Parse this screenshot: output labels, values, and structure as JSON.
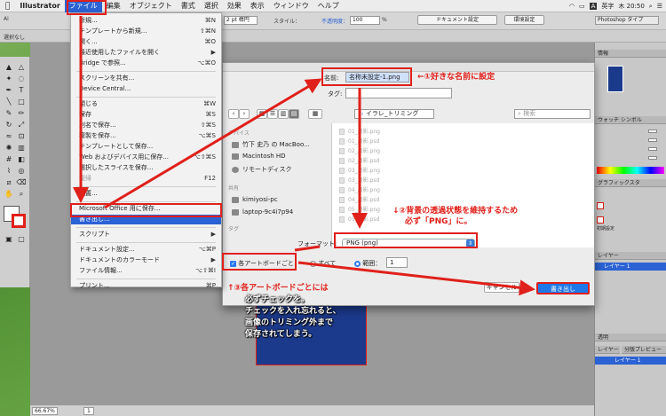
{
  "menubar": {
    "apple": "",
    "app": "Illustrator",
    "items": [
      "ファイル",
      "編集",
      "オブジェクト",
      "書式",
      "選択",
      "効果",
      "表示",
      "ウィンドウ",
      "ヘルプ"
    ],
    "status": [
      "A",
      "英字",
      "木 20:50"
    ]
  },
  "controlbar": {
    "select_label": "選択なし",
    "stroke_label": "2 pt 楕円",
    "style_label": "スタイル：",
    "opacity_label": "不透明度：",
    "opacity_value": "100",
    "opacity_unit": "%",
    "doc_settings": "ドキュメント設定",
    "env_settings": "環境設定",
    "workspace": "Photoshop タイプ"
  },
  "filemenu": {
    "items": [
      {
        "label": "新規...",
        "shortcut": "⌘N",
        "state": "normal"
      },
      {
        "label": "テンプレートから新規...",
        "shortcut": "⇧⌘N",
        "state": "normal"
      },
      {
        "label": "開く...",
        "shortcut": "⌘O",
        "state": "normal"
      },
      {
        "label": "最近使用したファイルを開く",
        "shortcut": "▶",
        "state": "normal"
      },
      {
        "label": "Bridge で参照...",
        "shortcut": "⌥⌘O",
        "state": "normal"
      },
      {
        "label": "スクリーンを共有...",
        "shortcut": "",
        "state": "normal"
      },
      {
        "label": "Device Central...",
        "shortcut": "",
        "state": "normal"
      },
      {
        "label": "閉じる",
        "shortcut": "⌘W",
        "state": "normal"
      },
      {
        "label": "保存",
        "shortcut": "⌘S",
        "state": "normal"
      },
      {
        "label": "別名で保存...",
        "shortcut": "⇧⌘S",
        "state": "normal"
      },
      {
        "label": "複製を保存...",
        "shortcut": "⌥⌘S",
        "state": "normal"
      },
      {
        "label": "テンプレートとして保存...",
        "shortcut": "",
        "state": "normal"
      },
      {
        "label": "Web およびデバイス用に保存...",
        "shortcut": "⌥⇧⌘S",
        "state": "normal"
      },
      {
        "label": "選択したスライスを保存...",
        "shortcut": "",
        "state": "normal"
      },
      {
        "label": "復帰",
        "shortcut": "F12",
        "state": "disabled"
      },
      {
        "label": "配置...",
        "shortcut": "",
        "state": "normal"
      },
      {
        "label": "Microsoft Office 用に保存...",
        "shortcut": "",
        "state": "normal"
      },
      {
        "label": "書き出し...",
        "shortcut": "",
        "state": "highlight"
      },
      {
        "label": "スクリプト",
        "shortcut": "▶",
        "state": "normal"
      },
      {
        "label": "ドキュメント設定...",
        "shortcut": "⌥⌘P",
        "state": "normal"
      },
      {
        "label": "ドキュメントのカラーモード",
        "shortcut": "▶",
        "state": "normal"
      },
      {
        "label": "ファイル情報...",
        "shortcut": "⌥⇧⌘I",
        "state": "normal"
      },
      {
        "label": "プリント...",
        "shortcut": "⌘P",
        "state": "normal"
      }
    ]
  },
  "dialog": {
    "name_label": "名前:",
    "name_value": "名称未設定-1.png",
    "tags_label": "タグ:",
    "folder": "イラレ_トリミング",
    "search_placeholder": "検索",
    "sidebar": {
      "devices_head": "デバイス",
      "devices": [
        "竹下 史乃 の MacBoo...",
        "Macintosh HD",
        "リモートディスク"
      ],
      "shared_head": "共有",
      "shared": [
        "kimiyosi-pc",
        "laptop-9c4i7p94"
      ],
      "tags_head": "タグ"
    },
    "files": [
      "01_鳥影.png",
      "01_鳥影.psd",
      "02_鳥影.png",
      "02_鳥影.psd",
      "03_鳥影.png",
      "03_鳥影.psd",
      "04_鳥影.png",
      "04_鳥影.psd",
      "05_鳥影.png",
      "05_鳥影.psd"
    ],
    "format_label": "フォーマット:",
    "format_value": "PNG (png)",
    "artboards_label": "各アートボードごと",
    "all_label": "すべて",
    "range_label": "範囲：",
    "range_value": "1",
    "cancel": "キャンセル",
    "export": "書き出し"
  },
  "rightpanels": {
    "info_tab": "情報",
    "swatch_tabs": "ウォッチ シンボル",
    "graphic_style": "グラフィックスタ",
    "initial_settings": "初期設定",
    "layer_tab": "レイヤー",
    "layer_row": "レイヤー 1",
    "transparency": "透明",
    "layers_tabs": [
      "レイヤー",
      "分版プレビュー"
    ],
    "layer_name": "レイヤー 1"
  },
  "statusbar": {
    "zoom": "66.67%",
    "page": "1"
  },
  "annotations": {
    "step1": "←①好きな名前に設定",
    "step2_line1": "↓②背景の透過状態を維持するため",
    "step2_line2": "必ず「PNG」に。",
    "step3_line1": "↑③各アートボードごとには",
    "step3_line2": "必ずチェックを。",
    "step3_line3": "チェックを入れ忘れると、",
    "step3_line4": "画像のトリミング外まで",
    "step3_line5": "保存されてしまう。"
  },
  "colors": {
    "accent_red": "#e0201a",
    "menu_highlight": "#2b62d4",
    "export_button": "#1f78e8"
  }
}
